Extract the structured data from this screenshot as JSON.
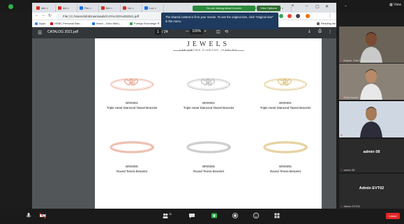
{
  "zoom": {
    "view_label": "View",
    "sharing_banner": "You are viewing Adnan's screen",
    "view_options": "View Options",
    "tooltip": "The shared content is fit to your screen. To see the original size, click \"Original size\" in the menu.",
    "leave_label": "Leave",
    "participant_count": "11"
  },
  "chrome": {
    "tabs": [
      {
        "label": "info",
        "color": "#d93025"
      },
      {
        "label": "Inb",
        "color": "#d93025"
      },
      {
        "label": "Pro",
        "color": "#1a73e8"
      },
      {
        "label": "Inb",
        "color": "#d93025"
      },
      {
        "label": "Lin",
        "color": "#d93025"
      },
      {
        "label": "Lov",
        "color": "#1a73e8"
      },
      {
        "label": "CR",
        "color": "#d93025"
      },
      {
        "label": "CR",
        "color": "#d93025"
      },
      {
        "label": "CR",
        "color": "#555555"
      }
    ],
    "new_tab": "+",
    "address": "File | C:/Users/info/Downloads/CATALOG%202021.pdf",
    "bookmarks": [
      {
        "label": "Apps",
        "color": "#4285f4"
      },
      {
        "label": "HSBC Personal Ban...",
        "color": "#db0011"
      },
      {
        "label": "Inbox - Zoho Mail (...",
        "color": "#1a73e8"
      },
      {
        "label": "Foreign Exchange R...",
        "color": "#34a853"
      },
      {
        "label": "CNBCTV18: Stock, S...",
        "color": "#444444"
      },
      {
        "label": "Mail - Siddhi V - Out...",
        "color": "#0072c6"
      },
      {
        "label": "Reading list",
        "color": "#666666"
      }
    ]
  },
  "pdf": {
    "title": "CATALOG 2021.pdf",
    "page_current": "1",
    "page_total": "/ 24",
    "zoom_minus": "—",
    "zoom_value": "100%",
    "zoom_plus": "+",
    "brand": "JEWELS",
    "tagline": "LAB GROWN DIAMOND JEWELRY",
    "products": [
      {
        "code": "BR00002",
        "name": "Triple Heart Diamond Tassel Bracelet",
        "metal": "#e6a58f",
        "kind": "heart"
      },
      {
        "code": "BR00002",
        "name": "Triple Heart Diamond Tassel Bracelet",
        "metal": "#b8b8b8",
        "kind": "heart"
      },
      {
        "code": "BR00002",
        "name": "Triple Heart Diamond Tassel Bracelet",
        "metal": "#dbbf7a",
        "kind": "heart"
      },
      {
        "code": "BR00005",
        "name": "Round Tennis Bracelet",
        "metal": "#e6a58f",
        "kind": "tennis"
      },
      {
        "code": "BR00005",
        "name": "Round Tennis Bracelet",
        "metal": "#b8b8b8",
        "kind": "tennis"
      },
      {
        "code": "BR00005",
        "name": "Round Tennis Bracelet",
        "metal": "#dbbf7a",
        "kind": "tennis"
      }
    ]
  },
  "participants": [
    {
      "label": "Expow- Thai Trade Centre Nair...",
      "type": "video",
      "skin": "#7a4a32",
      "bg": "#6b6358"
    },
    {
      "label": "Rohit Karule",
      "type": "video",
      "skin": "#b98a6a",
      "bg": "#8a8276"
    },
    {
      "label": "Abhilash Jain",
      "type": "video",
      "skin": "#a67a56",
      "bg": "#cfd8e2"
    },
    {
      "label": "admin 08",
      "type": "name",
      "name": "admin 08"
    },
    {
      "label": "Admin EVT02",
      "type": "name",
      "name": "Admin EVT02"
    }
  ],
  "colors": {
    "chrome_toolbar": "#323639",
    "pdf_bg": "#525659",
    "zoom_dark": "#1a1a1a",
    "leave": "#e02828"
  }
}
